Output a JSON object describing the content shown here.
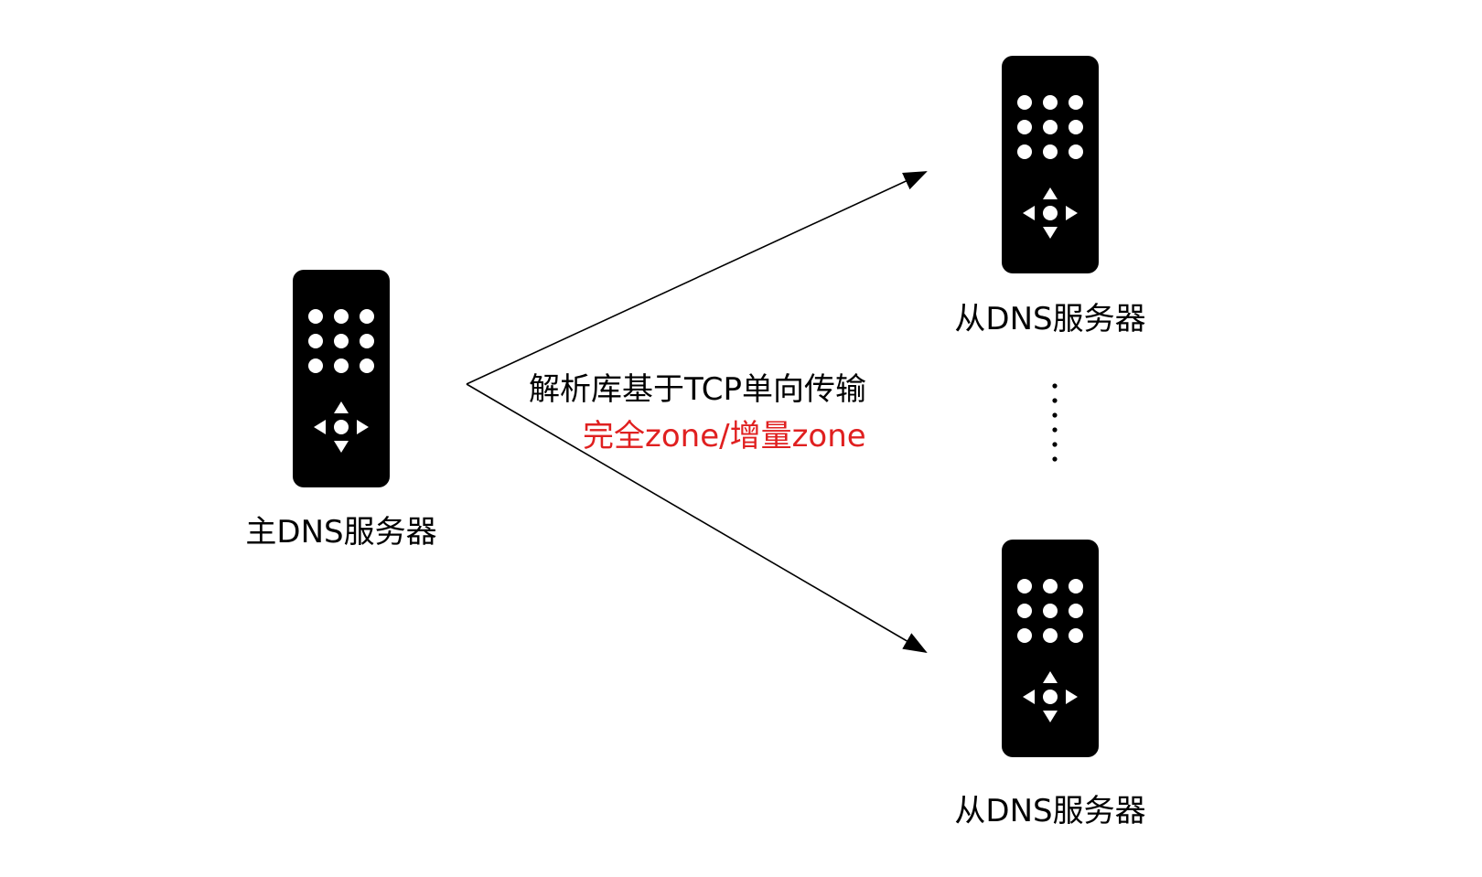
{
  "colors": {
    "background": "#ffffff",
    "server_body": "#000000",
    "server_buttons": "#ffffff",
    "line": "#000000",
    "label_text": "#000000",
    "highlight_text": "#e02020"
  },
  "primary_server": {
    "icon": "remote-control-server-icon",
    "label": "主DNS服务器"
  },
  "secondary_servers": [
    {
      "icon": "remote-control-server-icon",
      "label": "从DNS服务器"
    },
    {
      "icon": "remote-control-server-icon",
      "label": "从DNS服务器"
    }
  ],
  "transfer": {
    "label": "解析库基于TCP单向传输",
    "sublabel": "完全zone/增量zone"
  },
  "ellipsis_icon": "vertical-ellipsis-icon"
}
